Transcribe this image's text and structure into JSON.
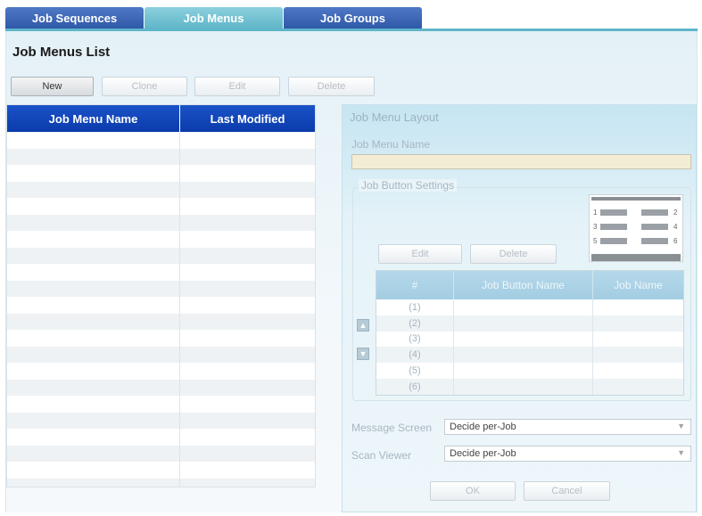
{
  "tabs": [
    {
      "label": "Job Sequences",
      "active": false
    },
    {
      "label": "Job Menus",
      "active": true
    },
    {
      "label": "Job Groups",
      "active": false
    }
  ],
  "page_title": "Job Menus List",
  "toolbar": {
    "new": "New",
    "clone": "Clone",
    "edit": "Edit",
    "delete": "Delete"
  },
  "list": {
    "headers": [
      "Job Menu Name",
      "Last Modified"
    ],
    "rows": []
  },
  "layout_panel": {
    "title": "Job Menu Layout",
    "name_label": "Job Menu Name",
    "name_value": "",
    "button_settings_label": "Job Button Settings",
    "edit": "Edit",
    "delete": "Delete",
    "preview_numbers": [
      "1",
      "2",
      "3",
      "4",
      "5",
      "6"
    ],
    "grid_headers": [
      "#",
      "Job Button Name",
      "Job Name"
    ],
    "grid_rows": [
      {
        "num": "(1)",
        "button": "",
        "job": ""
      },
      {
        "num": "(2)",
        "button": "",
        "job": ""
      },
      {
        "num": "(3)",
        "button": "",
        "job": ""
      },
      {
        "num": "(4)",
        "button": "",
        "job": ""
      },
      {
        "num": "(5)",
        "button": "",
        "job": ""
      },
      {
        "num": "(6)",
        "button": "",
        "job": ""
      }
    ],
    "up_icon": "triangle-up-icon",
    "down_icon": "triangle-down-icon",
    "message_screen_label": "Message Screen",
    "message_screen_value": "Decide per-Job",
    "scan_viewer_label": "Scan Viewer",
    "scan_viewer_value": "Decide per-Job",
    "ok": "OK",
    "cancel": "Cancel"
  },
  "colors": {
    "tab_inactive": "#2f58a8",
    "tab_active": "#5fb6c9",
    "list_header": "#0b3bab",
    "name_field": "#f3edd4"
  }
}
